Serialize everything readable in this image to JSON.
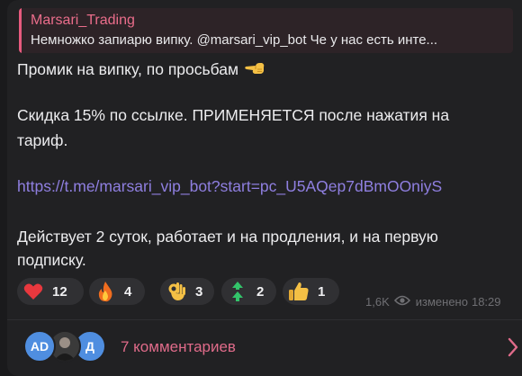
{
  "reply": {
    "author": "Marsari_Trading",
    "text": "Немножко запиарю випку. @marsari_vip_bot Че у нас есть инте..."
  },
  "message": {
    "line1": "Промик на випку, по просьбам",
    "line1_emoji": "pointing-hand-icon",
    "line2": "Скидка 15% по ссылке. ПРИМЕНЯЕТСЯ после нажатия на",
    "line3": "тариф.",
    "link": "https://t.me/marsari_vip_bot?start=pc_U5AQep7dBmOOniyS",
    "line4": "Действует 2 суток, работает и на продления, и на первую",
    "line5": "подписку."
  },
  "reactions": [
    {
      "icon": "heart-icon",
      "count": "12"
    },
    {
      "icon": "fire-icon",
      "count": "4"
    },
    {
      "icon": "ok-hand-icon",
      "count": "3"
    },
    {
      "icon": "double-arrow-up-icon",
      "count": "2"
    },
    {
      "icon": "thumbs-up-icon",
      "count": "1"
    }
  ],
  "meta": {
    "views": "1,6K",
    "edited_label": "изменено",
    "time": "18:29"
  },
  "comments": {
    "avatars": [
      "AD",
      "",
      "Д"
    ],
    "label": "7 комментариев"
  },
  "colors": {
    "accent": "#e06b8a",
    "link": "#8f7fe0",
    "avatar_blue": "#4f8ee0"
  }
}
